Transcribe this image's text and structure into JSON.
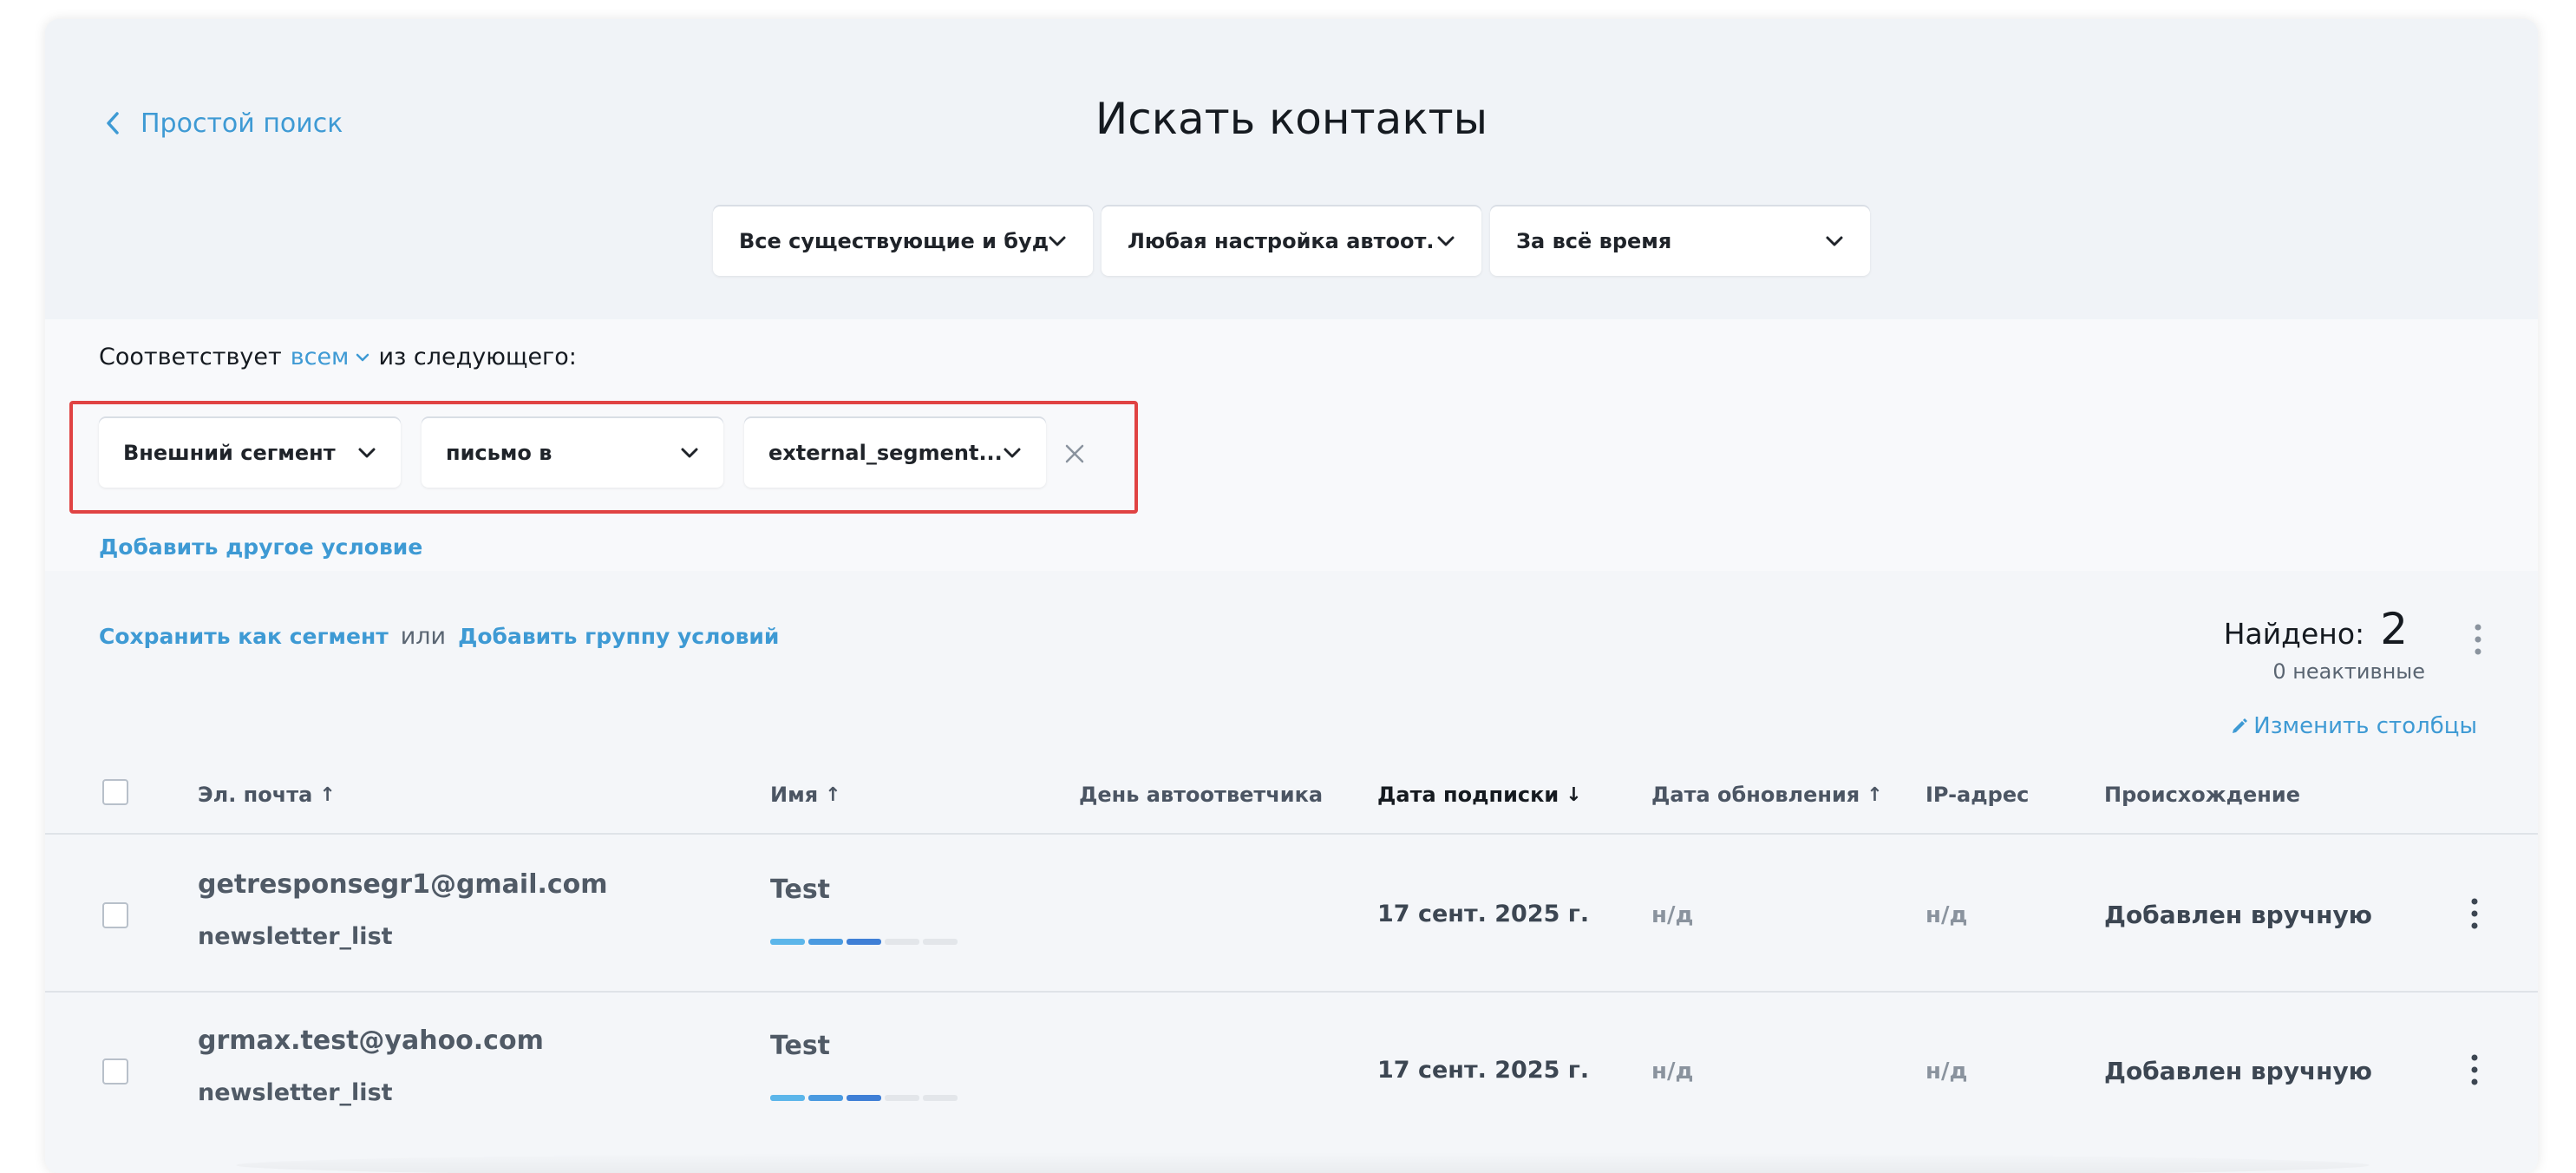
{
  "header": {
    "back_label": "Простой поиск",
    "title": "Искать контакты"
  },
  "filters": [
    {
      "label": "Все существующие и буд..."
    },
    {
      "label": "Любая настройка автоот..."
    },
    {
      "label": "За всё время"
    }
  ],
  "conditions": {
    "match_prefix": "Соответствует",
    "match_mode": "всем",
    "match_suffix": "из следующего:",
    "rule": {
      "field": "Внешний сегмент",
      "operator": "письмо в",
      "value": "external_segment..."
    },
    "add_condition": "Добавить другое условие"
  },
  "actions": {
    "save_segment": "Сохранить как сегмент",
    "or": "или",
    "add_group": "Добавить группу условий"
  },
  "summary": {
    "found_label": "Найдено:",
    "found_count": "2",
    "inactive": "0 неактивные",
    "edit_columns": "Изменить столбцы"
  },
  "table": {
    "columns": [
      {
        "label": "Эл. почта",
        "arrow": "↑"
      },
      {
        "label": "Имя",
        "arrow": "↑"
      },
      {
        "label": "День автоответчика",
        "arrow": ""
      },
      {
        "label": "Дата подписки",
        "arrow": "↓"
      },
      {
        "label": "Дата обновления",
        "arrow": "↑"
      },
      {
        "label": "IP-адрес",
        "arrow": ""
      },
      {
        "label": "Происхождение",
        "arrow": ""
      }
    ],
    "rows": [
      {
        "email": "getresponsegr1@gmail.com",
        "list": "newsletter_list",
        "name": "Test",
        "engagement_level": 3,
        "engagement_max": 5,
        "subscribed": "17 сент. 2025 г.",
        "updated": "н/д",
        "ip": "н/д",
        "origin": "Добавлен вручную"
      },
      {
        "email": "grmax.test@yahoo.com",
        "list": "newsletter_list",
        "name": "Test",
        "engagement_level": 3,
        "engagement_max": 5,
        "subscribed": "17 сент. 2025 г.",
        "updated": "н/д",
        "ip": "н/д",
        "origin": "Добавлен вручную"
      }
    ]
  },
  "colors": {
    "accent": "#3e9ad4",
    "highlight_border": "#e04343"
  }
}
